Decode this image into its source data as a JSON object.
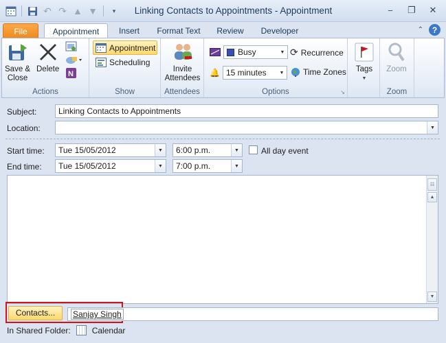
{
  "window": {
    "title": "Linking Contacts to Appointments  -  Appointment",
    "controls": {
      "minimize": "−",
      "restore": "❐",
      "close": "✕"
    }
  },
  "quick_access": {
    "icons": [
      "calendar-icon",
      "save-icon",
      "undo-icon",
      "redo-icon",
      "up-icon",
      "down-icon",
      "customize-icon"
    ]
  },
  "tabs": [
    {
      "label": "File",
      "state": "file"
    },
    {
      "label": "Appointment",
      "state": "active"
    },
    {
      "label": "Insert",
      "state": "normal"
    },
    {
      "label": "Format Text",
      "state": "normal"
    },
    {
      "label": "Review",
      "state": "normal"
    },
    {
      "label": "Developer",
      "state": "normal"
    }
  ],
  "ribbon": {
    "actions": {
      "label": "Actions",
      "save_close_line1": "Save &",
      "save_close_line2": "Close",
      "delete": "Delete"
    },
    "show": {
      "label": "Show",
      "appointment": "Appointment",
      "scheduling": "Scheduling"
    },
    "attendees": {
      "label": "Attendees",
      "invite_line1": "Invite",
      "invite_line2": "Attendees"
    },
    "options": {
      "label": "Options",
      "show_as": "Busy",
      "reminder": "15 minutes",
      "recurrence": "Recurrence",
      "time_zones": "Time Zones"
    },
    "tags": {
      "label": "Tags"
    },
    "zoom": {
      "label": "Zoom",
      "button": "Zoom"
    }
  },
  "form": {
    "subject_label": "Subject:",
    "subject_value": "Linking Contacts to Appointments",
    "location_label": "Location:",
    "location_value": "",
    "start_label": "Start time:",
    "start_date": "Tue 15/05/2012",
    "start_time": "6:00 p.m.",
    "all_day_label": "All day event",
    "all_day_checked": false,
    "end_label": "End time:",
    "end_date": "Tue 15/05/2012",
    "end_time": "7:00 p.m.",
    "contacts_button": "Contacts...",
    "contact_name": "Sanjay Singh",
    "folder_label": "In Shared Folder:",
    "folder_name": "Calendar"
  },
  "colors": {
    "accent_file_tab": "#f08b1d",
    "highlight": "#ffd86c",
    "callout_border": "#d0141a",
    "help_icon": "#3c78c8"
  }
}
